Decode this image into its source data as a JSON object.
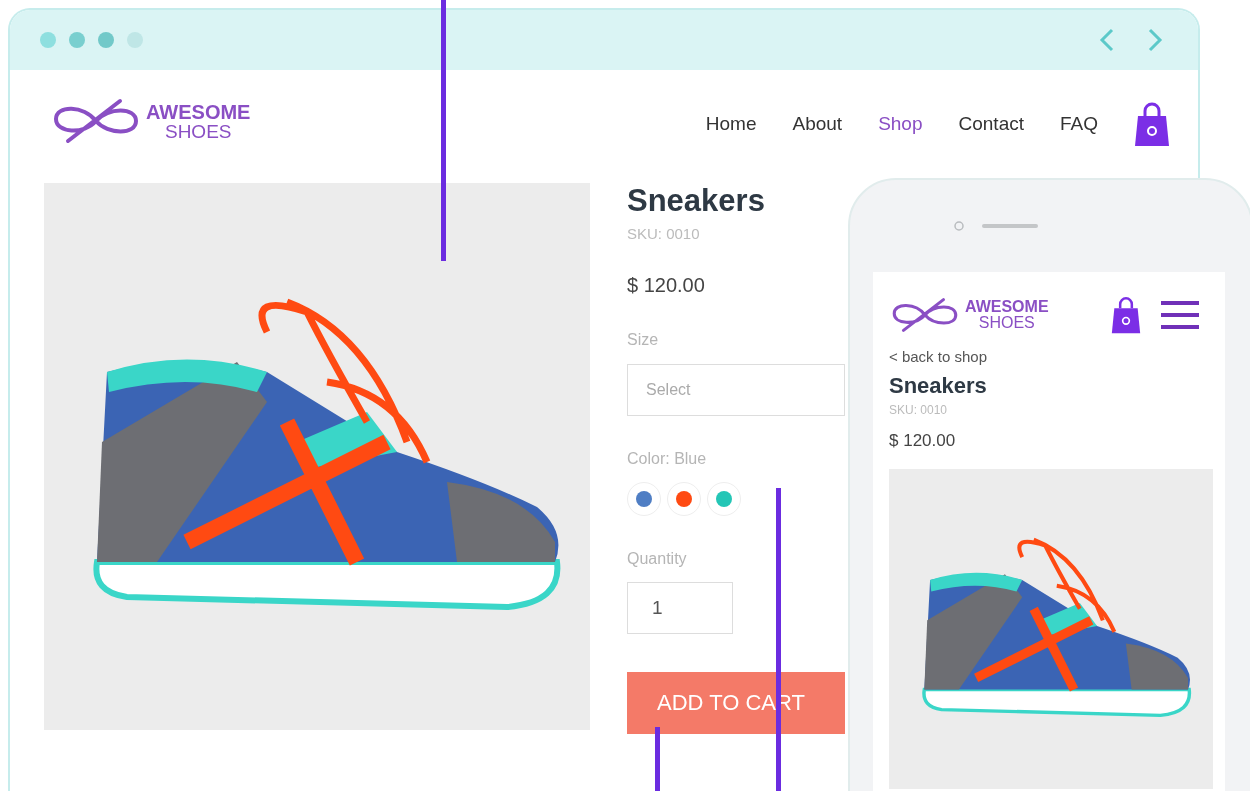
{
  "browser": {
    "logo": {
      "line1": "AWESOME",
      "line2": "SHOES"
    },
    "nav": [
      {
        "label": "Home",
        "selected": false
      },
      {
        "label": "About",
        "selected": false
      },
      {
        "label": "Shop",
        "selected": true
      },
      {
        "label": "Contact",
        "selected": false
      },
      {
        "label": "FAQ",
        "selected": false
      }
    ],
    "product": {
      "title": "Sneakers",
      "sku": "SKU: 0010",
      "price": "$ 120.00",
      "size_label": "Size",
      "size_select": {
        "placeholder": "Select"
      },
      "color_label": "Color: Blue",
      "swatches": [
        {
          "color": "#4f7ec4"
        },
        {
          "color": "#ff4a12"
        },
        {
          "color": "#24c6b6"
        }
      ],
      "quantity_label": "Quantity",
      "quantity": {
        "value": "1"
      },
      "add_button": "ADD TO CART"
    }
  },
  "phone": {
    "logo": {
      "line1": "AWESOME",
      "line2": "SHOES"
    },
    "back_link": "< back to shop",
    "title": "Sneakers",
    "sku": "SKU: 0010",
    "price": "$ 120.00"
  }
}
